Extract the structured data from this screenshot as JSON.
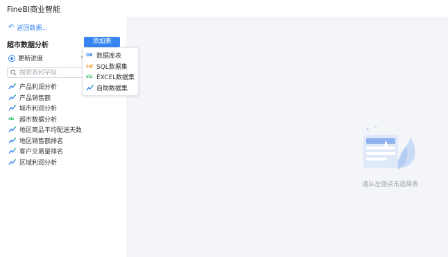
{
  "app": {
    "title": "FineBI商业智能"
  },
  "sidebar": {
    "back_label": "返回数据...",
    "package_title": "超市数据分析",
    "add_table_label": "添加表",
    "update_label": "更新进度",
    "search_placeholder": "搜索表和字段",
    "tables": [
      {
        "label": "产品利润分析",
        "icon": "trend-icon"
      },
      {
        "label": "产品销售额",
        "icon": "trend-icon"
      },
      {
        "label": "城市利润分析",
        "icon": "trend-icon"
      },
      {
        "label": "超市数据分析",
        "icon": "excel-icon"
      },
      {
        "label": "地区商品平均配送天数",
        "icon": "trend-icon"
      },
      {
        "label": "地区销售额排名",
        "icon": "trend-icon"
      },
      {
        "label": "客户交易量排名",
        "icon": "trend-icon"
      },
      {
        "label": "区域利润分析",
        "icon": "trend-icon"
      }
    ]
  },
  "dropdown": {
    "items": [
      {
        "label": "数据库表",
        "badge": "DB"
      },
      {
        "label": "SQL数据集",
        "badge": "sql"
      },
      {
        "label": "EXCEL数据集",
        "badge": "xls"
      },
      {
        "label": "自助数据集",
        "badge": ""
      }
    ]
  },
  "main": {
    "empty_hint": "请从左侧点击选择表"
  },
  "colors": {
    "accent": "#3685f2",
    "panel_bg": "#f4f5f8",
    "excel": "#2dbd63",
    "sql": "#f39a1e"
  }
}
